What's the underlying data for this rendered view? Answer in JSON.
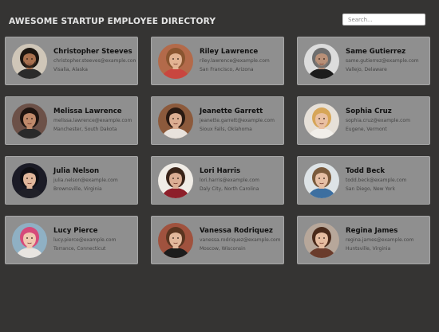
{
  "header": {
    "title": "AWESOME STARTUP EMPLOYEE DIRECTORY",
    "search_placeholder": "Search..."
  },
  "employees": [
    {
      "name": "Christopher Steeves",
      "email": "christopher.steeves@example.com",
      "location": "Visalia, Alaska",
      "avatar": {
        "bg": "#cfc6b8",
        "skin": "#a8714f",
        "hair": "#1c1611",
        "shirt": "#2b2b2b",
        "beard": true
      }
    },
    {
      "name": "Riley Lawrence",
      "email": "riley.lawrence@example.com",
      "location": "San Francisco, Arizona",
      "avatar": {
        "bg": "#b36a4a",
        "skin": "#e2b393",
        "hair": "#8a5530",
        "shirt": "#c9463f",
        "beard": false
      }
    },
    {
      "name": "Same Gutierrez",
      "email": "same.gutierrez@example.com",
      "location": "Vallejo, Delaware",
      "avatar": {
        "bg": "#dcdcdc",
        "skin": "#b89078",
        "hair": "#6e6e6e",
        "shirt": "#1c1c1c",
        "beard": true
      }
    },
    {
      "name": "Melissa Lawrence",
      "email": "melissa.lawrence@example.com",
      "location": "Manchester, South Dakota",
      "avatar": {
        "bg": "#6c5148",
        "skin": "#c08a6b",
        "hair": "#1e1410",
        "shirt": "#2a2a2a",
        "beard": false
      }
    },
    {
      "name": "Jeanette Garrett",
      "email": "jeanette.garrett@example.com",
      "location": "Sioux Falls, Oklahoma",
      "avatar": {
        "bg": "#8c5a3c",
        "skin": "#dcae92",
        "hair": "#2a1a12",
        "shirt": "#e8e2dc",
        "beard": false
      }
    },
    {
      "name": "Sophia Cruz",
      "email": "sophia.cruz@example.com",
      "location": "Eugene, Vermont",
      "avatar": {
        "bg": "#e6e0d8",
        "skin": "#e9c0a3",
        "hair": "#d6a558",
        "shirt": "#f1eee9",
        "beard": false
      }
    },
    {
      "name": "Julia Nelson",
      "email": "julia.nelson@example.com",
      "location": "Brownsville, Virginia",
      "avatar": {
        "bg": "#1b1b26",
        "skin": "#e0b69b",
        "hair": "#0f0f14",
        "shirt": "#202028",
        "beard": false
      }
    },
    {
      "name": "Lori Harris",
      "email": "lori.harris@example.com",
      "location": "Daly City, North Carolina",
      "avatar": {
        "bg": "#f0ece6",
        "skin": "#dcae94",
        "hair": "#3a2419",
        "shirt": "#8d1f2a",
        "beard": false
      }
    },
    {
      "name": "Todd Beck",
      "email": "todd.beck@example.com",
      "location": "San Diego, New York",
      "avatar": {
        "bg": "#dde3e6",
        "skin": "#e6bfa5",
        "hair": "#7a5a3c",
        "shirt": "#3d6fa0",
        "beard": false
      }
    },
    {
      "name": "Lucy Pierce",
      "email": "lucy.pierce@example.com",
      "location": "Torrance, Connecticut",
      "avatar": {
        "bg": "#8fb0c4",
        "skin": "#f0c8b0",
        "hair": "#d64a7a",
        "shirt": "#e8e4e0",
        "beard": false
      }
    },
    {
      "name": "Vanessa Rodriquez",
      "email": "vanessa.rodriquez@example.com",
      "location": "Moscow, Wisconsin",
      "avatar": {
        "bg": "#a0523e",
        "skin": "#e3b89c",
        "hair": "#5a3520",
        "shirt": "#1c1c1c",
        "beard": false
      }
    },
    {
      "name": "Regina James",
      "email": "regina.james@example.com",
      "location": "Huntsville, Virginia",
      "avatar": {
        "bg": "#b7a79a",
        "skin": "#e5bca0",
        "hair": "#4a2a1a",
        "shirt": "#6a3c2c",
        "beard": false
      }
    }
  ]
}
